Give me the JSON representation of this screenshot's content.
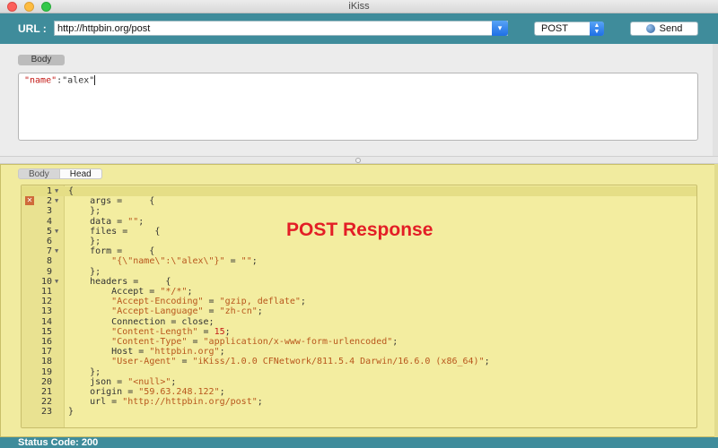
{
  "window": {
    "title": "iKiss"
  },
  "toolbar": {
    "url_label": "URL :",
    "url_value": "http://httpbin.org/post",
    "method": "POST",
    "send_label": "Send"
  },
  "request": {
    "tab_label": "Body",
    "body_key": "\"name\"",
    "body_colon": ":",
    "body_value": "\"alex\""
  },
  "response": {
    "tabs": [
      {
        "label": "Body"
      },
      {
        "label": "Head"
      }
    ],
    "title": "POST Response",
    "lines": [
      {
        "num": "1",
        "fold": true,
        "text": "{"
      },
      {
        "num": "2",
        "fold": true,
        "error": true,
        "text": "    args =     {"
      },
      {
        "num": "3",
        "fold": false,
        "text": "    };"
      },
      {
        "num": "4",
        "fold": false,
        "text": "    data = \"\";"
      },
      {
        "num": "5",
        "fold": true,
        "text": "    files =     {"
      },
      {
        "num": "6",
        "fold": false,
        "text": "    };"
      },
      {
        "num": "7",
        "fold": true,
        "text": "    form =     {"
      },
      {
        "num": "8",
        "fold": false,
        "text": "        \"{\\\"name\\\":\\\"alex\\\"}\" = \"\";"
      },
      {
        "num": "9",
        "fold": false,
        "text": "    };"
      },
      {
        "num": "10",
        "fold": true,
        "text": "    headers =     {"
      },
      {
        "num": "11",
        "fold": false,
        "text": "        Accept = \"*/*\";"
      },
      {
        "num": "12",
        "fold": false,
        "text": "        \"Accept-Encoding\" = \"gzip, deflate\";"
      },
      {
        "num": "13",
        "fold": false,
        "text": "        \"Accept-Language\" = \"zh-cn\";"
      },
      {
        "num": "14",
        "fold": false,
        "text": "        Connection = close;"
      },
      {
        "num": "15",
        "fold": false,
        "text": "        \"Content-Length\" = 15;"
      },
      {
        "num": "16",
        "fold": false,
        "text": "        \"Content-Type\" = \"application/x-www-form-urlencoded\";"
      },
      {
        "num": "17",
        "fold": false,
        "text": "        Host = \"httpbin.org\";"
      },
      {
        "num": "18",
        "fold": false,
        "text": "        \"User-Agent\" = \"iKiss/1.0.0 CFNetwork/811.5.4 Darwin/16.6.0 (x86_64)\";"
      },
      {
        "num": "19",
        "fold": false,
        "text": "    };"
      },
      {
        "num": "20",
        "fold": false,
        "text": "    json = \"<null>\";"
      },
      {
        "num": "21",
        "fold": false,
        "text": "    origin = \"59.63.248.122\";"
      },
      {
        "num": "22",
        "fold": false,
        "text": "    url = \"http://httpbin.org/post\";"
      },
      {
        "num": "23",
        "fold": false,
        "text": "}"
      }
    ]
  },
  "status": {
    "text": "Status Code:  200"
  },
  "colors": {
    "toolbar": "#3f8c9b",
    "response_bg": "#f1eb9f",
    "title_red": "#e31e26",
    "string_orange": "#b8561c"
  },
  "icons": [
    "close-window-icon",
    "minimize-window-icon",
    "maximize-window-icon",
    "chevron-down-icon",
    "stepper-icon",
    "globe-icon",
    "error-icon",
    "fold-arrow-icon"
  ]
}
